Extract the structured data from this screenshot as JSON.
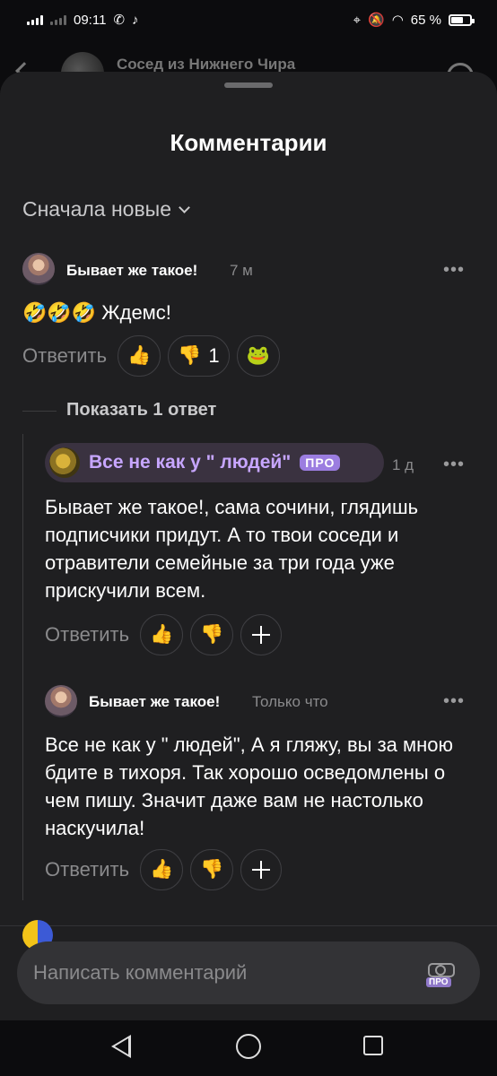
{
  "status_bar": {
    "time": "09:11",
    "battery": "65 %",
    "battery_level": 0.65,
    "icons": [
      "signal-icon",
      "whatsapp-icon",
      "tiktok-icon",
      "location-icon",
      "mute-icon",
      "wifi-icon",
      "battery-icon"
    ]
  },
  "background": {
    "channel_title": "Сосед из Нижнего Чира"
  },
  "sheet": {
    "title": "Комментарии",
    "sort_label": "Сначала новые"
  },
  "comments": [
    {
      "author": "Бывает же такое!",
      "time": "7 м",
      "text": "🤣🤣🤣 Ждемс!",
      "reply_label": "Ответить",
      "reactions": [
        {
          "emoji": "👍",
          "count": ""
        },
        {
          "emoji": "👎",
          "count": "1"
        },
        {
          "emoji": "🐸",
          "count": ""
        }
      ]
    }
  ],
  "show_replies_label": "Показать 1 ответ",
  "replies": [
    {
      "author": "Все не как у \" людей\"",
      "badge": "ПРО",
      "time": "1 д",
      "text": "Бывает же такое!, сама сочини, глядишь подписчики придут. А то твои соседи и отравители семейные за три года уже прискучили всем.",
      "reply_label": "Ответить"
    },
    {
      "author": "Бывает же такое!",
      "time": "Только что",
      "text": "Все не как у \" людей\", А я гляжу, вы за мною бдите в тихоря. Так хорошо осведомлены о чем пишу. Значит даже вам не настолько наскучила!",
      "reply_label": "Ответить"
    }
  ],
  "reaction_emoji": {
    "like": "👍",
    "dislike": "👎"
  },
  "composer": {
    "placeholder": "Написать комментарий",
    "pro_badge": "ПРО"
  },
  "more_menu": "•••",
  "colors": {
    "sheet_bg": "#1f1f21",
    "accent_pro": "#c7a6ff",
    "muted": "#8a8a8c"
  }
}
